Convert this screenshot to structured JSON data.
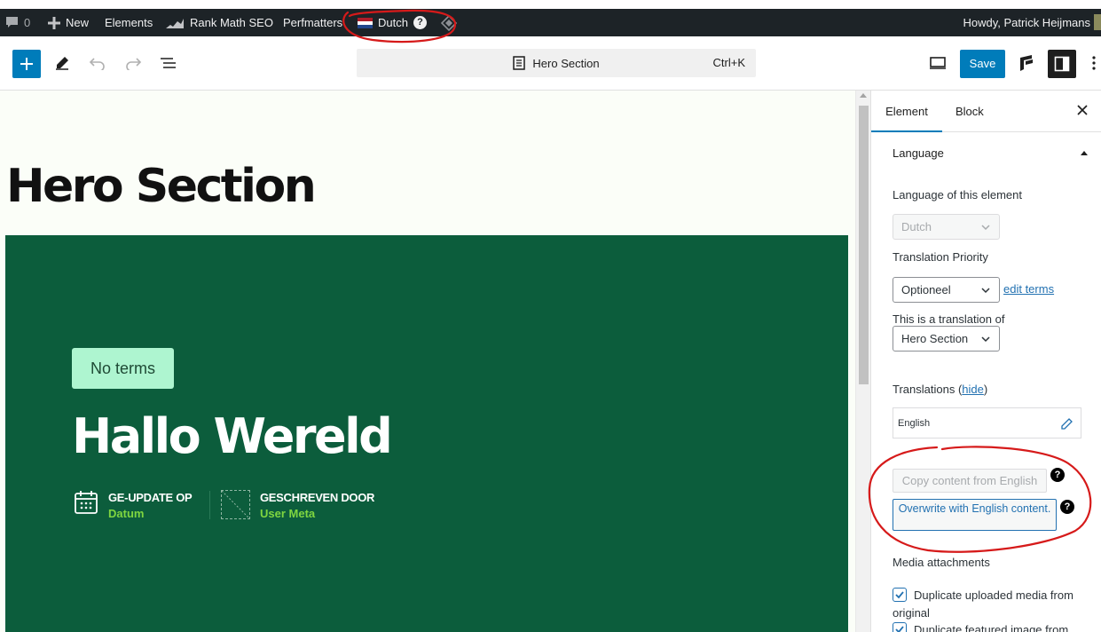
{
  "admin_bar": {
    "comments_count": "0",
    "new_label": "New",
    "elements_label": "Elements",
    "rank_math_label": "Rank Math SEO",
    "perfmatters_label": "Perfmatters",
    "language_label": "Dutch",
    "help_glyph": "?",
    "greeting": "Howdy, Patrick Heijmans"
  },
  "editor_header": {
    "document_title": "Hero Section",
    "shortcut": "Ctrl+K",
    "save_label": "Save"
  },
  "canvas": {
    "page_title": "Hero Section",
    "hero": {
      "badge": "No terms",
      "heading": "Hallo Wereld",
      "meta": [
        {
          "label": "GE-UPDATE OP",
          "value": "Datum"
        },
        {
          "label": "GESCHREVEN DOOR",
          "value": "User Meta"
        }
      ]
    }
  },
  "sidebar": {
    "tabs": [
      {
        "label": "Element",
        "active": true
      },
      {
        "label": "Block",
        "active": false
      }
    ],
    "panel_title": "Language",
    "language_of_element_label": "Language of this element",
    "language_value": "Dutch",
    "translation_priority_label": "Translation Priority",
    "translation_priority_value": "Optioneel",
    "edit_terms_link": "edit terms",
    "translation_of_label": "This is a translation of",
    "translation_of_value": "Hero Section",
    "translations_label": "Translations",
    "hide_link": "hide",
    "translation_language": "English",
    "copy_button": "Copy content from English",
    "overwrite_button": "Overwrite with English content.",
    "help_glyph": "?",
    "media_attachments_label": "Media attachments",
    "duplicate_media_label": "Duplicate uploaded media from original",
    "duplicate_featured_label": "Duplicate featured image from"
  },
  "colors": {
    "admin_bar_bg": "#1d2327",
    "primary_blue": "#007cba",
    "hero_green": "#0c5d3c",
    "badge_mint": "#aef5d0",
    "meta_value_green": "#7fd640",
    "annotation_red": "#d61a1a"
  }
}
